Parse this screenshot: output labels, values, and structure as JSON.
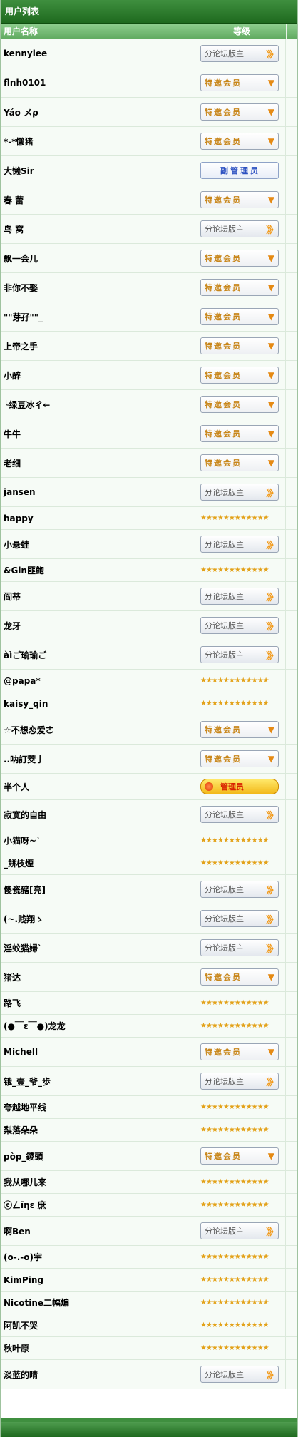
{
  "title": "用户列表",
  "columns": {
    "name": "用户名称",
    "level": "等级"
  },
  "badges": {
    "moderator": "分论坛版主",
    "member": "特邀会员",
    "vice_admin": "副管理员",
    "admin": "管理员"
  },
  "colors": {
    "header_green": "#2e7d2e",
    "column_head": "#6fb96f",
    "row_bg": "#f6fbf6",
    "stars": "#e3a21a"
  },
  "rows": [
    {
      "name": "kennylee",
      "badge": "moderator",
      "h": 41
    },
    {
      "name": "flnh0101",
      "badge": "member",
      "h": 41
    },
    {
      "name": "Yáo メρ",
      "badge": "member",
      "h": 41
    },
    {
      "name": "*-*懒猪",
      "badge": "member",
      "h": 41
    },
    {
      "name": "大懒Sir",
      "badge": "vice_admin",
      "h": 41
    },
    {
      "name": "春 蕾",
      "badge": "member",
      "h": 41
    },
    {
      "name": "鸟 窝",
      "badge": "moderator",
      "h": 41
    },
    {
      "name": "飘一会儿",
      "badge": "member",
      "h": 41
    },
    {
      "name": "非你不娶",
      "badge": "member",
      "h": 41
    },
    {
      "name": "\"\"芽孖\"\"_",
      "badge": "member",
      "h": 41
    },
    {
      "name": "上帝之手",
      "badge": "member",
      "h": 41
    },
    {
      "name": "小醉",
      "badge": "member",
      "h": 41
    },
    {
      "name": "╰绿豆冰ㄔ←",
      "badge": "member",
      "h": 41
    },
    {
      "name": "牛牛",
      "badge": "member",
      "h": 41
    },
    {
      "name": "老细",
      "badge": "member",
      "h": 41
    },
    {
      "name": "jansen",
      "badge": "moderator",
      "h": 41
    },
    {
      "name": "happy",
      "badge": "stars",
      "h": 32
    },
    {
      "name": "小悬蛙",
      "badge": "moderator",
      "h": 41
    },
    {
      "name": "&Gin匪鲍",
      "badge": "stars",
      "h": 32
    },
    {
      "name": "阎蒂",
      "badge": "moderator",
      "h": 41
    },
    {
      "name": "龙牙",
      "badge": "moderator",
      "h": 41
    },
    {
      "name": "àìご瑜瑜ご",
      "badge": "moderator",
      "h": 41
    },
    {
      "name": "@papa*",
      "badge": "stars",
      "h": 32
    },
    {
      "name": "kaisy_qin",
      "badge": "stars",
      "h": 32
    },
    {
      "name": "☆不想恋爱ㄜ",
      "badge": "member",
      "h": 41
    },
    {
      "name": "..呐訂茭亅",
      "badge": "member",
      "h": 41
    },
    {
      "name": "半个人",
      "badge": "admin",
      "h": 37
    },
    {
      "name": "寂寞的自由",
      "badge": "moderator",
      "h": 41
    },
    {
      "name": "小猫呀~`",
      "badge": "stars",
      "h": 32
    },
    {
      "name": "_餅枝煙",
      "badge": "stars",
      "h": 32
    },
    {
      "name": "傻瓷豬[亮]",
      "badge": "moderator",
      "h": 41
    },
    {
      "name": "(~.贱翔ゝ",
      "badge": "moderator",
      "h": 41
    },
    {
      "name": "淫蚊猫婦`",
      "badge": "moderator",
      "h": 41
    },
    {
      "name": "猪达",
      "badge": "member",
      "h": 41
    },
    {
      "name": "路飞",
      "badge": "stars",
      "h": 32
    },
    {
      "name": "(●￣ε￣●)龙龙",
      "badge": "stars",
      "h": 32
    },
    {
      "name": "Michell",
      "badge": "member",
      "h": 41
    },
    {
      "name": "锇_壹_爷_歩",
      "badge": "moderator",
      "h": 41
    },
    {
      "name": "夸越地平线",
      "badge": "stars",
      "h": 32
    },
    {
      "name": "梨落朵朵",
      "badge": "stars",
      "h": 32
    },
    {
      "name": "pòp_鑁頭",
      "badge": "member",
      "h": 41
    },
    {
      "name": "我从哪儿来",
      "badge": "stars",
      "h": 32
    },
    {
      "name": "ⓔㄥīηε 庶",
      "badge": "stars",
      "h": 32
    },
    {
      "name": "啊Ben",
      "badge": "moderator",
      "h": 41
    },
    {
      "name": "(o-.-o)宇",
      "badge": "stars",
      "h": 32
    },
    {
      "name": "KimPing",
      "badge": "stars",
      "h": 32
    },
    {
      "name": "Nicotine二幅煸",
      "badge": "stars",
      "h": 32
    },
    {
      "name": "阿凯不哭",
      "badge": "stars",
      "h": 32
    },
    {
      "name": "秋叶原",
      "badge": "stars",
      "h": 32
    },
    {
      "name": "淡蓝的晴",
      "badge": "moderator",
      "h": 41
    }
  ]
}
